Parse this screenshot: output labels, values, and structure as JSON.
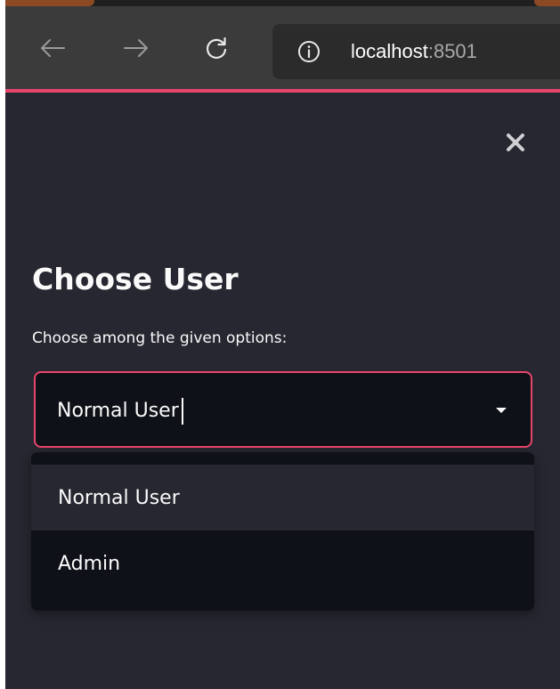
{
  "browser": {
    "url_host": "localhost",
    "url_port": ":8501",
    "icons": {
      "back": "arrow-left-icon",
      "forward": "arrow-right-icon",
      "reload": "reload-icon",
      "info": "info-circle-icon"
    }
  },
  "app": {
    "title": "Choose User",
    "select_label": "Choose among the given options:",
    "selected_value": "Normal User",
    "options": [
      "Normal User",
      "Admin"
    ],
    "highlighted_option": "Normal User",
    "colors": {
      "accent": "#e8456b",
      "background": "#262730",
      "input_background": "#0e1117",
      "text": "#fafafa"
    }
  }
}
